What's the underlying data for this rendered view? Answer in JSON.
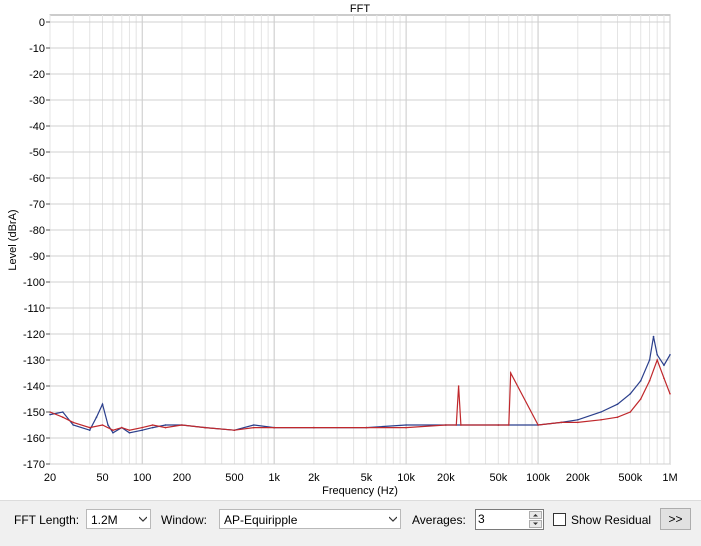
{
  "chart_data": {
    "type": "line",
    "title": "FFT",
    "xlabel": "Frequency (Hz)",
    "ylabel": "Level (dBrA)",
    "xscale": "log",
    "xlim": [
      20,
      1000000
    ],
    "ylim": [
      -170,
      0
    ],
    "grid": true,
    "x_ticks": [
      {
        "value": 20,
        "label": "20"
      },
      {
        "value": 50,
        "label": "50"
      },
      {
        "value": 100,
        "label": "100"
      },
      {
        "value": 200,
        "label": "200"
      },
      {
        "value": 500,
        "label": "500"
      },
      {
        "value": 1000,
        "label": "1k"
      },
      {
        "value": 2000,
        "label": "2k"
      },
      {
        "value": 5000,
        "label": "5k"
      },
      {
        "value": 10000,
        "label": "10k"
      },
      {
        "value": 20000,
        "label": "20k"
      },
      {
        "value": 50000,
        "label": "50k"
      },
      {
        "value": 100000,
        "label": "100k"
      },
      {
        "value": 200000,
        "label": "200k"
      },
      {
        "value": 500000,
        "label": "500k"
      },
      {
        "value": 1000000,
        "label": "1M"
      }
    ],
    "y_ticks": [
      {
        "value": 0,
        "label": "0"
      },
      {
        "value": -10,
        "label": "-10"
      },
      {
        "value": -20,
        "label": "-20"
      },
      {
        "value": -30,
        "label": "-30"
      },
      {
        "value": -40,
        "label": "-40"
      },
      {
        "value": -50,
        "label": "-50"
      },
      {
        "value": -60,
        "label": "-60"
      },
      {
        "value": -70,
        "label": "-70"
      },
      {
        "value": -80,
        "label": "-80"
      },
      {
        "value": -90,
        "label": "-90"
      },
      {
        "value": -100,
        "label": "-100"
      },
      {
        "value": -110,
        "label": "-110"
      },
      {
        "value": -120,
        "label": "-120"
      },
      {
        "value": -130,
        "label": "-130"
      },
      {
        "value": -140,
        "label": "-140"
      },
      {
        "value": -150,
        "label": "-150"
      },
      {
        "value": -160,
        "label": "-160"
      },
      {
        "value": -170,
        "label": "-170"
      }
    ],
    "series": [
      {
        "color": "#2b3f8c",
        "x": [
          20,
          25,
          30,
          40,
          45,
          50,
          55,
          60,
          70,
          80,
          100,
          120,
          150,
          200,
          300,
          500,
          700,
          1000,
          2000,
          5000,
          10000,
          20000,
          50000,
          100000,
          150000,
          200000,
          300000,
          400000,
          500000,
          600000,
          700000,
          750000,
          800000,
          900000,
          1000000
        ],
        "y": [
          -151,
          -150,
          -155,
          -157,
          -152,
          -147,
          -155,
          -158,
          -156,
          -158,
          -157,
          -156,
          -155,
          -155,
          -156,
          -157,
          -155,
          -156,
          -156,
          -156,
          -155,
          -155,
          -155,
          -155,
          -154,
          -153,
          -150,
          -147,
          -143,
          -138,
          -130,
          -121,
          -128,
          -132,
          -128
        ]
      },
      {
        "color": "#c0282c",
        "x": [
          20,
          25,
          30,
          40,
          50,
          60,
          70,
          80,
          100,
          120,
          150,
          200,
          300,
          500,
          700,
          1000,
          2000,
          5000,
          10000,
          20000,
          24000,
          25000,
          26000,
          50000,
          60000,
          62000,
          100000,
          150000,
          200000,
          300000,
          400000,
          500000,
          600000,
          700000,
          800000,
          900000,
          1000000
        ],
        "y": [
          -150,
          -152,
          -154,
          -156,
          -155,
          -157,
          -156,
          -157,
          -156,
          -155,
          -156,
          -155,
          -156,
          -157,
          -156,
          -156,
          -156,
          -156,
          -156,
          -155,
          -155,
          -140,
          -155,
          -155,
          -155,
          -135,
          -155,
          -154,
          -154,
          -153,
          -152,
          -150,
          -145,
          -138,
          -130,
          -137,
          -143
        ]
      }
    ]
  },
  "controls": {
    "fft_length_label": "FFT Length:",
    "fft_length_value": "1.2M",
    "window_label": "Window:",
    "window_value": "AP-Equiripple",
    "averages_label": "Averages:",
    "averages_value": "3",
    "show_residual_label": "Show Residual",
    "show_residual_checked": false,
    "more_button_label": ">>"
  }
}
